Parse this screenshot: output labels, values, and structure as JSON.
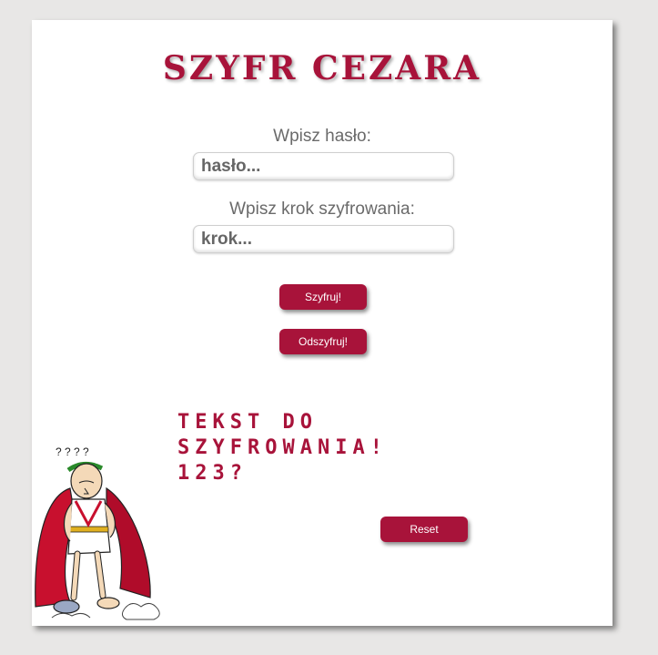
{
  "title": "SZYFR CEZARA",
  "password": {
    "label": "Wpisz hasło:",
    "placeholder": "hasło...",
    "value": ""
  },
  "step": {
    "label": "Wpisz krok szyfrowania:",
    "placeholder": "krok...",
    "value": ""
  },
  "buttons": {
    "encrypt": "Szyfruj!",
    "decrypt": "Odszyfruj!",
    "reset": "Reset"
  },
  "output_text": "Tekst do szyfrowania! 123?",
  "colors": {
    "accent": "#a8133a",
    "background": "#e8e7e6",
    "card": "#ffffff",
    "label": "#6a6a6a"
  }
}
